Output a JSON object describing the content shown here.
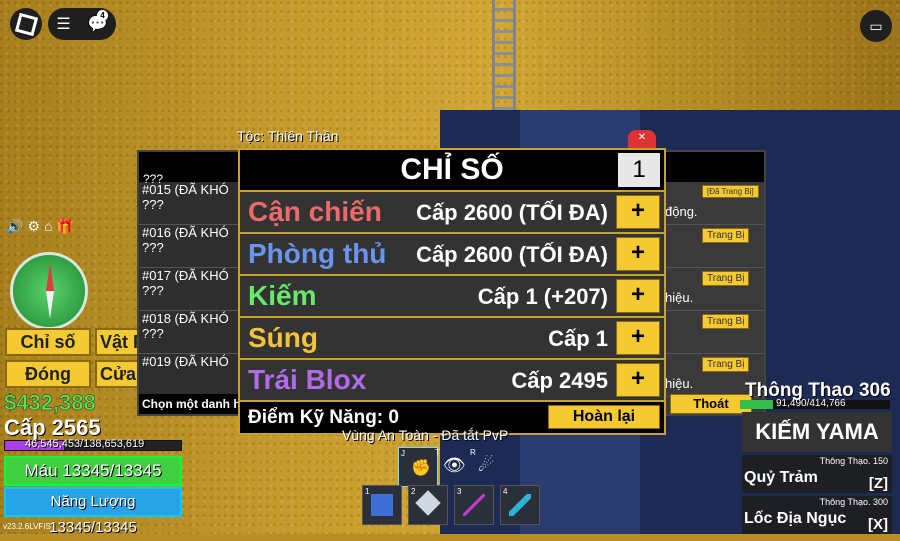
{
  "topbar": {
    "chat_badge": "4"
  },
  "left_menu": {
    "stats_btn": "Chỉ số",
    "items_btn": "Vật P",
    "close_btn": "Đóng",
    "shop_btn": "Cửa h"
  },
  "player": {
    "money": "$432,388",
    "level": "Cấp 2565",
    "xp": "46,545,453/138,653,619",
    "xp_fraction": 0.336,
    "hp": "Máu 13345/13345",
    "energy": "Năng Lượng 13345/13345",
    "version": "v23.2.6LVFIS"
  },
  "left_list": {
    "rows": [
      {
        "id": "#015 (ĐÃ KHÓ",
        "q": "???"
      },
      {
        "id": "#016 (ĐÃ KHÓ",
        "q": "???"
      },
      {
        "id": "#017 (ĐÃ KHÓ",
        "q": "???"
      },
      {
        "id": "#018 (ĐÃ KHÓ",
        "q": "???"
      },
      {
        "id": "#019 (ĐÃ KHÓ",
        "q": ""
      }
    ],
    "top_q": "???",
    "choose": "Chọn một danh h"
  },
  "right_list": {
    "rows": [
      {
        "btn": "[Đã Trang Bị]",
        "text": "động."
      },
      {
        "btn": "Trang Bị",
        "text": ""
      },
      {
        "btn": "Trang Bị",
        "text": "hiệu."
      },
      {
        "btn": "Trang Bị",
        "text": ""
      },
      {
        "btn": "Trang Bị",
        "text": "hiệu."
      }
    ],
    "exit": "Thoát"
  },
  "race": "Tộc: Thiên Thần",
  "stats_panel": {
    "title": "CHỈ SỐ",
    "points_step": "1",
    "rows": [
      {
        "name": "Cận chiến",
        "value": "Cấp 2600 (TỐI ĐA)",
        "color": "#ee6a6a"
      },
      {
        "name": "Phòng thủ",
        "value": "Cấp 2600 (TỐI ĐA)",
        "color": "#6a95ee"
      },
      {
        "name": "Kiếm",
        "value": "Cấp 1 (+207)",
        "color": "#6ae86a"
      },
      {
        "name": "Súng",
        "value": "Cấp 1",
        "color": "#f2c23a"
      },
      {
        "name": "Trái Blox",
        "value": "Cấp 2495",
        "color": "#b26ae8"
      }
    ],
    "plus_label": "+",
    "skill_points": "Điểm Kỹ Năng: 0",
    "reset": "Hoàn lại"
  },
  "zone": "Vùng An Toàn - Đã tắt PvP",
  "hotbar": {
    "slots": [
      "1",
      "2",
      "3",
      "4"
    ],
    "abilities": [
      "J",
      "T",
      "R"
    ]
  },
  "weapon_hud": {
    "sport": "Thông Thao 306",
    "sport_xp": "91,490/414,766",
    "sport_fraction": 0.22,
    "weapon": "KIẾM YAMA",
    "skills": [
      {
        "req": "Thông Thạo. 150",
        "name": "Quỷ Trảm",
        "key": "[Z]"
      },
      {
        "req": "Thông Thạo. 300",
        "name": "Lốc Địa Ngục",
        "key": "[X]"
      }
    ]
  }
}
